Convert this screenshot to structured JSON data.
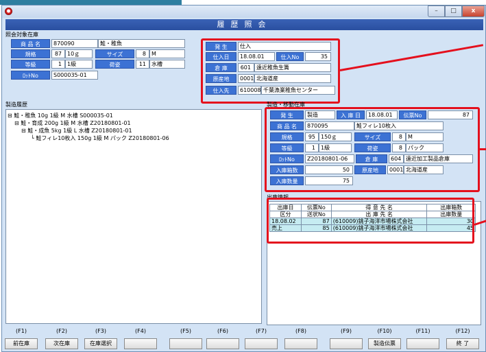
{
  "title": "履歴照会",
  "window_buttons": {
    "minimize": "–",
    "maximize": "□",
    "close": "x"
  },
  "inventory": {
    "caption": "照会対象在庫",
    "product_label": "商 品 名",
    "product_code": "870090",
    "product_name": "鮭・稚魚",
    "spec_label": "規格",
    "spec_qty": "87",
    "spec_unit": "10ｇ",
    "size_label": "サイズ",
    "size_qty": "8",
    "size_value": "M",
    "grade_label": "等級",
    "grade_qty": "1",
    "grade_value": "1級",
    "packing_label": "荷姿",
    "packing_qty": "11",
    "packing_value": "水槽",
    "lot_label": "ﾛｯﾄNo",
    "lot_value": "S000035-01"
  },
  "origin": {
    "occurrence_label": "発 生",
    "occurrence_value": "仕入",
    "date_label": "仕入日",
    "date_value": "18.08.01",
    "slip_label": "仕入No",
    "slip_value": "35",
    "warehouse_label": "倉 庫",
    "warehouse_code": "601",
    "warehouse_name": "遠近稚魚生簀",
    "place_label": "原産地",
    "place_code": "0001",
    "place_name": "北海道産",
    "supplier_label": "仕入先",
    "supplier_code": "610008",
    "supplier_name": "千葉漁業稚魚センター"
  },
  "history": {
    "caption": "製造履歴",
    "lines": [
      "⊟ 鮭・稚魚 10g 1級 M 水槽 S000035-01",
      "⊟ 鮭・育成 200g 1級 M 水槽 Z20180801-01",
      "⊟ 鮭・成魚 5kg 1級 L 水槽 Z20180801-01",
      "└ 鮭フィレ10枚入 150g 1級 M パック Z20180801-06"
    ]
  },
  "production": {
    "caption": "製造・移動在庫",
    "occurrence_label": "発 生",
    "occurrence_value": "製造",
    "date_label": "入 庫 日",
    "date_value": "18.08.01",
    "slip_label": "伝票No",
    "slip_value": "87",
    "product_label": "商 品 名",
    "product_code": "870095",
    "product_name": "鮭フィレ10枚入",
    "spec_label": "規格",
    "spec_qty": "95",
    "spec_unit": "150ｇ",
    "size_label": "サイズ",
    "size_qty": "8",
    "size_value": "M",
    "grade_label": "等級",
    "grade_qty": "1",
    "grade_value": "1級",
    "packing_label": "荷姿",
    "packing_qty": "8",
    "packing_value": "パック",
    "lot_label": "ﾛｯﾄNo",
    "lot_value": "Z20180801-06",
    "warehouse_label": "倉 庫",
    "warehouse_code": "604",
    "warehouse_name": "遠近加工製品倉庫",
    "boxes_label": "入庫箱数",
    "boxes_value": "50",
    "place_label": "原産地",
    "place_code": "0001",
    "place_name": "北海道産",
    "qty_label": "入庫数量",
    "qty_value": "75"
  },
  "shipping": {
    "caption": "出庫情報",
    "headers_row1": [
      "出庫日",
      "伝票No",
      "得 意 先 名",
      "出庫箱数"
    ],
    "headers_row2": [
      "区分",
      "送状No",
      "出 庫 先 名",
      "出庫数量"
    ],
    "rows": [
      {
        "col1": "18.08.02",
        "col2": "87",
        "col3": "(610009)銚子海洋市場株式会社",
        "col4": "30"
      },
      {
        "col1": "売上",
        "col2": "85",
        "col3": "(610009)銚子海洋市場株式会社",
        "col4": "45"
      }
    ]
  },
  "function_keys": [
    {
      "key": "(F1)",
      "label": "前在庫"
    },
    {
      "key": "(F2)",
      "label": "次在庫"
    },
    {
      "key": "(F3)",
      "label": "在庫選択"
    },
    {
      "key": "(F4)",
      "label": ""
    },
    {
      "key": "(F5)",
      "label": ""
    },
    {
      "key": "(F6)",
      "label": ""
    },
    {
      "key": "(F7)",
      "label": ""
    },
    {
      "key": "(F8)",
      "label": ""
    },
    {
      "key": "(F9)",
      "label": ""
    },
    {
      "key": "(F10)",
      "label": "製造伝票"
    },
    {
      "key": "(F11)",
      "label": ""
    },
    {
      "key": "(F12)",
      "label": "終 了"
    }
  ],
  "colors": {
    "label_bg": "#3c72d4",
    "form_bg": "#d3e3f5",
    "highlight": "#e4101d",
    "row_bg": "#c6ecf2"
  }
}
